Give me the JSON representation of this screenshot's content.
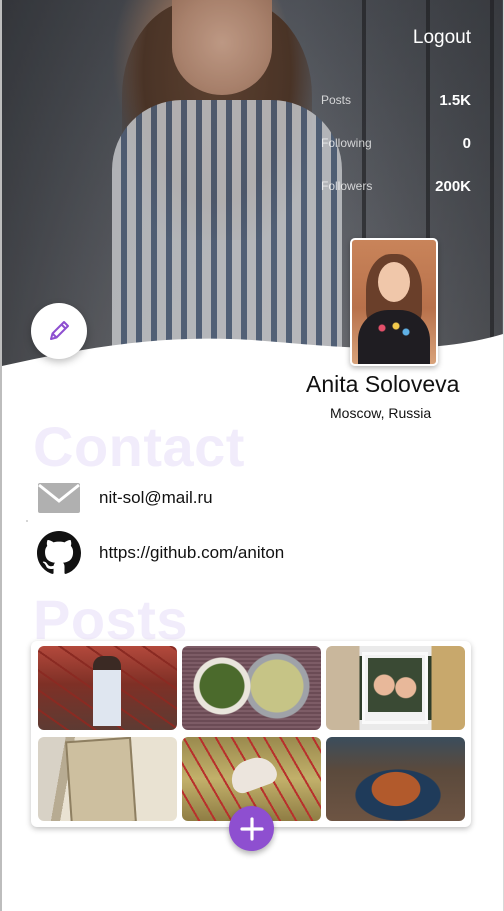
{
  "header": {
    "logout_label": "Logout"
  },
  "stats": [
    {
      "label": "Posts",
      "value": "1.5K"
    },
    {
      "label": "Following",
      "value": "0"
    },
    {
      "label": "Followers",
      "value": "200K"
    }
  ],
  "profile": {
    "name": "Anita Soloveva",
    "location": "Moscow, Russia"
  },
  "contact": {
    "heading": "Contact",
    "email": "nit-sol@mail.ru",
    "github": "https://github.com/aniton"
  },
  "posts": {
    "heading": "Posts",
    "items": [
      {
        "subject": "woman-on-red-rope-playground"
      },
      {
        "subject": "plates-of-food-on-table"
      },
      {
        "subject": "polaroid-of-two-friends"
      },
      {
        "subject": "old-history-book"
      },
      {
        "subject": "sneakers-on-red-rope-net"
      },
      {
        "subject": "croissant-on-blue-plate"
      }
    ]
  },
  "colors": {
    "accent": "#8e4fd0",
    "heading_watermark": "#f1ecfb",
    "icon_gray": "#b0b0b0"
  },
  "icons": {
    "edit": "pencil-icon",
    "email": "mail-icon",
    "github": "github-icon",
    "add": "plus-icon"
  }
}
